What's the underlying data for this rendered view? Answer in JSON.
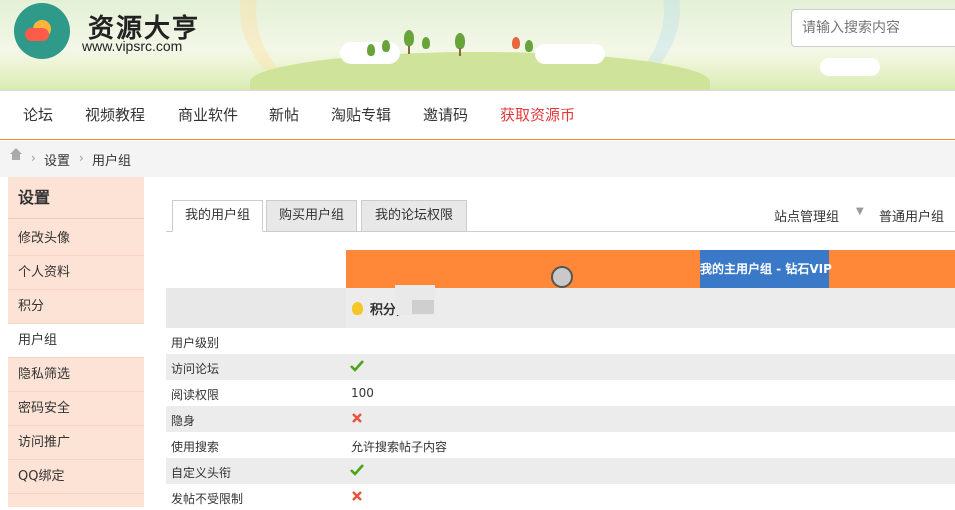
{
  "site": {
    "title": "资源大亨",
    "url": "www.vipsrc.com",
    "search_placeholder": "请输入搜索内容",
    "accent": "#f08b3a"
  },
  "nav": [
    {
      "label": "论坛"
    },
    {
      "label": "视频教程"
    },
    {
      "label": "商业软件"
    },
    {
      "label": "新帖"
    },
    {
      "label": "淘贴专辑"
    },
    {
      "label": "邀请码"
    },
    {
      "label": "获取资源币",
      "color": "#e4393c"
    }
  ],
  "breadcrumb": {
    "items": [
      "设置",
      "用户组"
    ],
    "separator": "›"
  },
  "sidebar": {
    "title": "设置",
    "items": [
      {
        "label": "修改头像"
      },
      {
        "label": "个人资料"
      },
      {
        "label": "积分"
      },
      {
        "label": "用户组",
        "active": true
      },
      {
        "label": "隐私筛选"
      },
      {
        "label": "密码安全"
      },
      {
        "label": "访问推广"
      },
      {
        "label": "QQ绑定"
      }
    ]
  },
  "tabs": [
    {
      "label": "我的用户组",
      "active": true
    },
    {
      "label": "购买用户组"
    },
    {
      "label": "我的论坛权限"
    }
  ],
  "right_links": {
    "admin_group": "站点管理组",
    "normal_group": "普通用户组"
  },
  "group_header": {
    "label": "我的主用户组 - 钻石VIP",
    "band_color": "#ff8838",
    "box_color": "#3a79c8"
  },
  "score": {
    "label": "积分,"
  },
  "permissions": [
    {
      "label": "用户级别",
      "value": "",
      "icon": ""
    },
    {
      "label": "访问论坛",
      "value": "",
      "icon": "check-icon"
    },
    {
      "label": "阅读权限",
      "value": "100",
      "icon": ""
    },
    {
      "label": "隐身",
      "value": "",
      "icon": "cross-icon"
    },
    {
      "label": "使用搜索",
      "value": "允许搜索帖子内容",
      "icon": ""
    },
    {
      "label": "自定义头衔",
      "value": "",
      "icon": "check-icon"
    },
    {
      "label": "发帖不受限制",
      "value": "",
      "icon": "cross-icon"
    }
  ]
}
